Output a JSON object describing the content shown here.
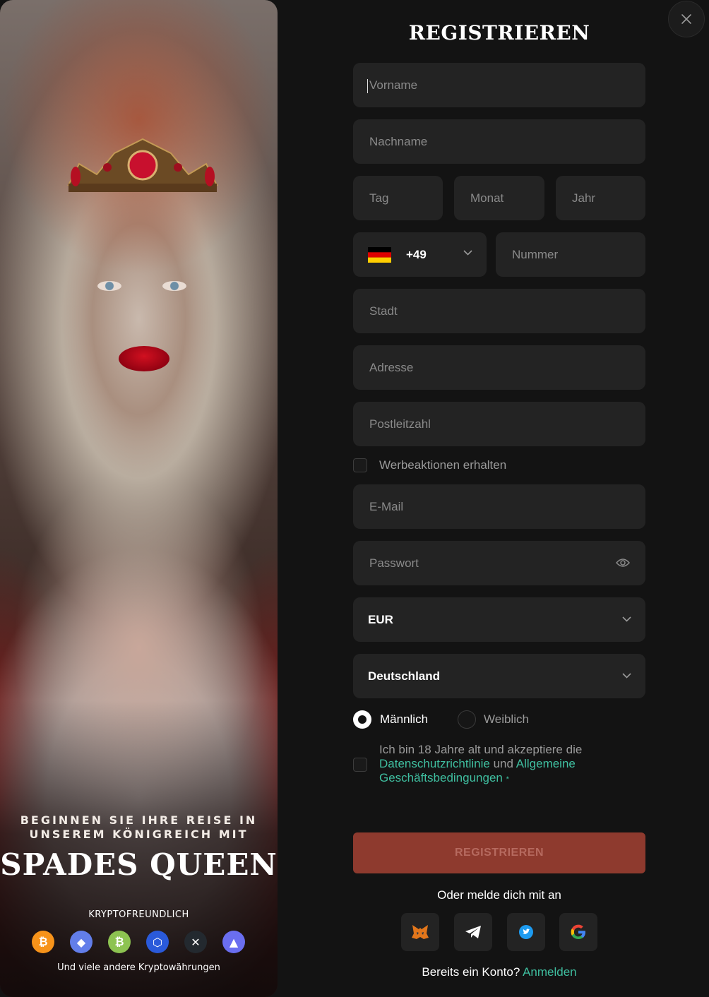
{
  "promo": {
    "tagline_line1": "BEGINNEN SIE IHRE REISE IN",
    "tagline_line2": "UNSEREM KÖNIGREICH MIT",
    "brand": "SPADES QUEEN",
    "crypto_label": "KRYPTOFREUNDLICH",
    "coins": [
      {
        "icon": "bitcoin-icon",
        "glyph": "₿",
        "color": "#f7931a"
      },
      {
        "icon": "ethereum-icon",
        "glyph": "◆",
        "color": "#627eea"
      },
      {
        "icon": "bitcoin-cash-icon",
        "glyph": "₿",
        "color": "#8dc351"
      },
      {
        "icon": "chainlink-icon",
        "glyph": "⬡",
        "color": "#2a5ada"
      },
      {
        "icon": "ripple-icon",
        "glyph": "✕",
        "color": "#23292f"
      },
      {
        "icon": "tron-icon",
        "glyph": "▲",
        "color": "#6a6ef0"
      }
    ],
    "more_text": "Und viele andere Kryptowährungen"
  },
  "form": {
    "title": "REGISTRIEREN",
    "first_name_placeholder": "Vorname",
    "last_name_placeholder": "Nachname",
    "day_placeholder": "Tag",
    "month_placeholder": "Monat",
    "year_placeholder": "Jahr",
    "phone_code": "+49",
    "phone_flag": "germany-flag-icon",
    "number_placeholder": "Nummer",
    "city_placeholder": "Stadt",
    "address_placeholder": "Adresse",
    "zip_placeholder": "Postleitzahl",
    "promo_checkbox_label": "Werbeaktionen erhalten",
    "email_placeholder": "E-Mail",
    "password_placeholder": "Passwort",
    "currency": "EUR",
    "country": "Deutschland",
    "gender_male": "Männlich",
    "gender_female": "Weiblich",
    "gender_selected": "male",
    "terms_text": "Ich bin 18 Jahre alt und akzeptiere die",
    "terms_link1": "Datenschutzrichtlinie",
    "terms_and": "und",
    "terms_link2": "Allgemeine Geschäftsbedingungen",
    "terms_required": "*",
    "register_button": "REGISTRIEREN",
    "or_text": "Oder melde dich mit an",
    "social": [
      "metamask-icon",
      "telegram-icon",
      "twitter-icon",
      "google-icon"
    ],
    "login_prompt": "Bereits ein Konto?",
    "login_link": "Anmelden"
  },
  "colors": {
    "background": "#131313",
    "field": "#232323",
    "accent_link": "#3fbfa0",
    "register_button": "#8e3a2e"
  }
}
